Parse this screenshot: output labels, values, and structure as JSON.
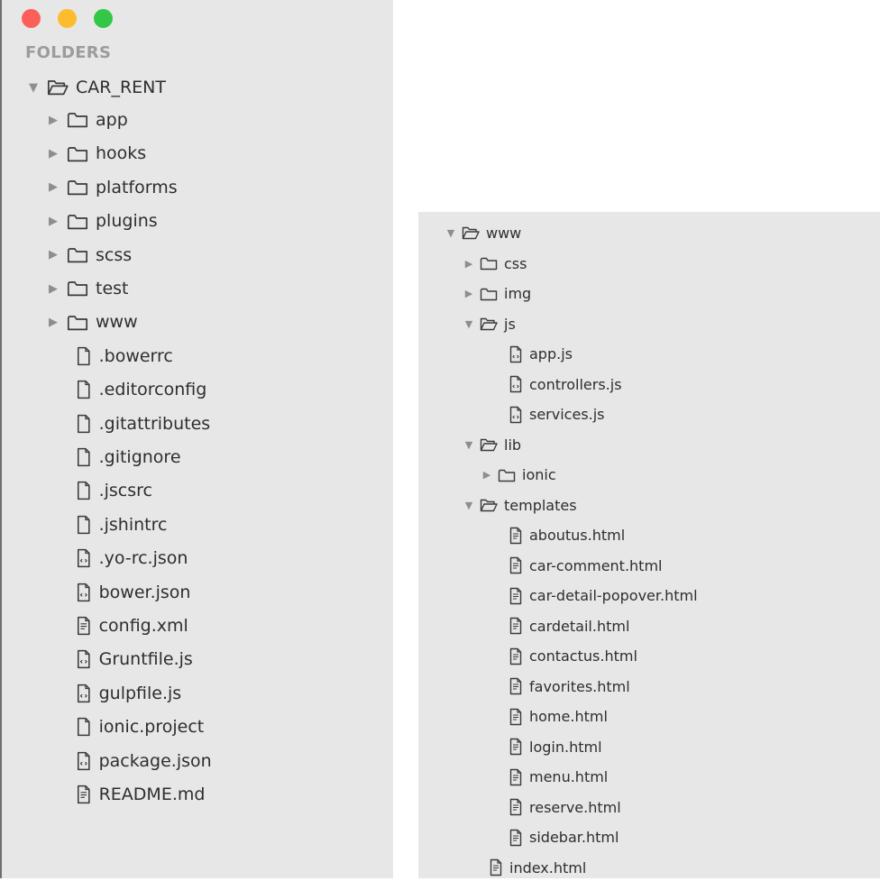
{
  "window": {
    "traffic_lights": [
      {
        "name": "close",
        "color": "#fc5f57"
      },
      {
        "name": "minimize",
        "color": "#fdbc2e"
      },
      {
        "name": "zoom",
        "color": "#33c748"
      }
    ]
  },
  "left_panel": {
    "section_label": "FOLDERS",
    "root": {
      "label": "CAR_RENT",
      "expanded": true
    },
    "items": [
      {
        "label": "app",
        "kind": "folder",
        "expanded": false
      },
      {
        "label": "hooks",
        "kind": "folder",
        "expanded": false
      },
      {
        "label": "platforms",
        "kind": "folder",
        "expanded": false
      },
      {
        "label": "plugins",
        "kind": "folder",
        "expanded": false
      },
      {
        "label": "scss",
        "kind": "folder",
        "expanded": false
      },
      {
        "label": "test",
        "kind": "folder",
        "expanded": false
      },
      {
        "label": "www",
        "kind": "folder",
        "expanded": false
      },
      {
        "label": ".bowerrc",
        "kind": "file"
      },
      {
        "label": ".editorconfig",
        "kind": "file"
      },
      {
        "label": ".gitattributes",
        "kind": "file"
      },
      {
        "label": ".gitignore",
        "kind": "file"
      },
      {
        "label": ".jscsrc",
        "kind": "file"
      },
      {
        "label": ".jshintrc",
        "kind": "file"
      },
      {
        "label": ".yo-rc.json",
        "kind": "code"
      },
      {
        "label": "bower.json",
        "kind": "code"
      },
      {
        "label": "config.xml",
        "kind": "markup"
      },
      {
        "label": "Gruntfile.js",
        "kind": "code"
      },
      {
        "label": "gulpfile.js",
        "kind": "code"
      },
      {
        "label": "ionic.project",
        "kind": "file"
      },
      {
        "label": "package.json",
        "kind": "code"
      },
      {
        "label": "README.md",
        "kind": "markup"
      }
    ]
  },
  "right_panel": {
    "root": {
      "label": "www",
      "expanded": true
    },
    "items": [
      {
        "label": "css",
        "kind": "folder",
        "expanded": false,
        "depth": 1
      },
      {
        "label": "img",
        "kind": "folder",
        "expanded": false,
        "depth": 1
      },
      {
        "label": "js",
        "kind": "folder",
        "expanded": true,
        "depth": 1
      },
      {
        "label": "app.js",
        "kind": "code",
        "depth": 2
      },
      {
        "label": "controllers.js",
        "kind": "code",
        "depth": 2
      },
      {
        "label": "services.js",
        "kind": "code",
        "depth": 2
      },
      {
        "label": "lib",
        "kind": "folder",
        "expanded": true,
        "depth": 1
      },
      {
        "label": "ionic",
        "kind": "folder",
        "expanded": false,
        "depth": 2
      },
      {
        "label": "templates",
        "kind": "folder",
        "expanded": true,
        "depth": 1
      },
      {
        "label": "aboutus.html",
        "kind": "markup",
        "depth": 2
      },
      {
        "label": "car-comment.html",
        "kind": "markup",
        "depth": 2
      },
      {
        "label": "car-detail-popover.html",
        "kind": "markup",
        "depth": 2
      },
      {
        "label": "cardetail.html",
        "kind": "markup",
        "depth": 2
      },
      {
        "label": "contactus.html",
        "kind": "markup",
        "depth": 2
      },
      {
        "label": "favorites.html",
        "kind": "markup",
        "depth": 2
      },
      {
        "label": "home.html",
        "kind": "markup",
        "depth": 2
      },
      {
        "label": "login.html",
        "kind": "markup",
        "depth": 2
      },
      {
        "label": "menu.html",
        "kind": "markup",
        "depth": 2
      },
      {
        "label": "reserve.html",
        "kind": "markup",
        "depth": 2
      },
      {
        "label": "sidebar.html",
        "kind": "markup",
        "depth": 2
      },
      {
        "label": "index.html",
        "kind": "markup",
        "depth": 1
      }
    ]
  }
}
